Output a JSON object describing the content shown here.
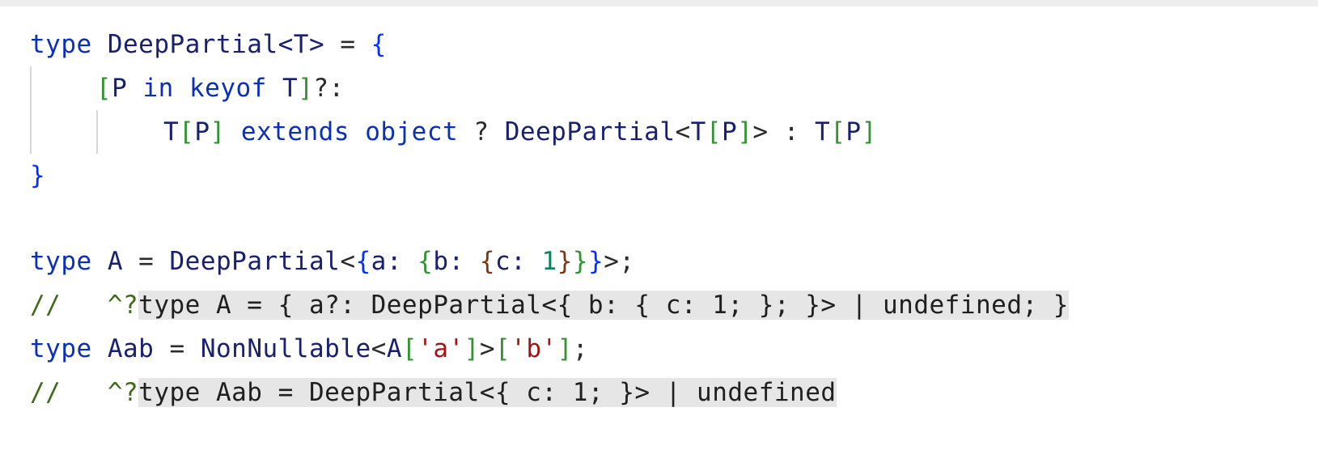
{
  "code": {
    "line1": {
      "kw_type": "type",
      "name": "DeepPartial",
      "generic": "<T>",
      "eq": "=",
      "open": "{"
    },
    "line2": {
      "open": "[",
      "p": "P",
      "in": "in",
      "keyof": "keyof",
      "t": "T",
      "close": "]",
      "optional": "?:"
    },
    "line3": {
      "t1": "T",
      "br1_open": "[",
      "p1": "P",
      "br1_close": "]",
      "extends": "extends",
      "object": "object",
      "q": "?",
      "name": "DeepPartial",
      "lt": "<",
      "t2": "T",
      "br2_open": "[",
      "p2": "P",
      "br2_close": "]",
      "gt": ">",
      "colon": ":",
      "t3": "T",
      "br3_open": "[",
      "p3": "P",
      "br3_close": "]"
    },
    "line4": {
      "close": "}"
    },
    "line5": {
      "kw_type": "type",
      "name": "A",
      "eq": "=",
      "fn": "DeepPartial",
      "lt": "<",
      "b1_open": "{",
      "a": "a:",
      "b2_open": "{",
      "b": "b:",
      "b3_open": "{",
      "c": "c:",
      "one": "1",
      "b3_close": "}",
      "b2_close": "}",
      "b1_close": "}",
      "tail": ">;"
    },
    "line6": {
      "comment": "//",
      "caret": "^?",
      "hint": "type A = { a?: DeepPartial<{ b: { c: 1; }; }> | undefined; }"
    },
    "line7": {
      "kw_type": "type",
      "name": "Aab",
      "eq": "=",
      "fn": "NonNullable",
      "lt": "<",
      "a": "A",
      "br1_open": "[",
      "key1": "'a'",
      "br1_close": "]",
      "gt": ">",
      "br2_open": "[",
      "key2": "'b'",
      "br2_close": "]",
      "semi": ";"
    },
    "line8": {
      "comment": "//",
      "caret": "^?",
      "hint": "type Aab = DeepPartial<{ c: 1; }> | undefined"
    }
  }
}
